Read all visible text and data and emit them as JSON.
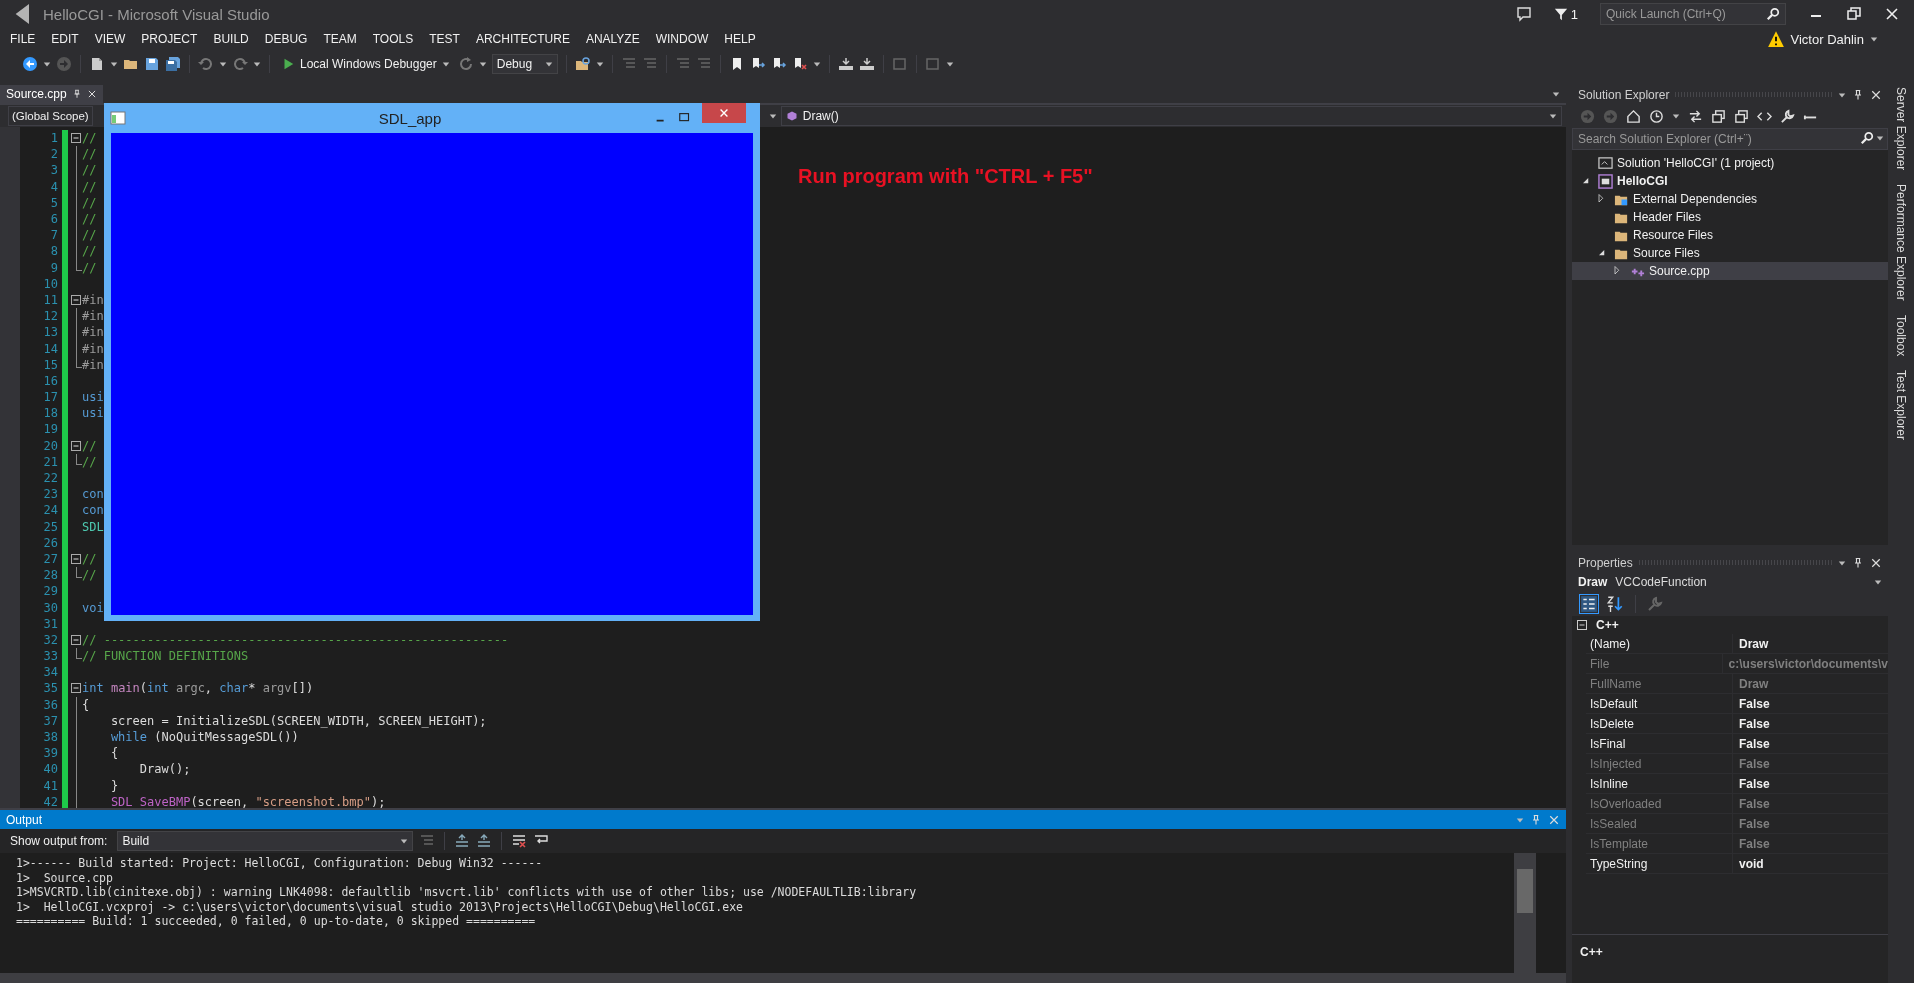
{
  "window": {
    "title": "HelloCGI - Microsoft Visual Studio",
    "notification_count": "1",
    "quick_launch": {
      "placeholder": "Quick Launch (Ctrl+Q)"
    }
  },
  "menu": [
    "FILE",
    "EDIT",
    "VIEW",
    "PROJECT",
    "BUILD",
    "DEBUG",
    "TEAM",
    "TOOLS",
    "TEST",
    "ARCHITECTURE",
    "ANALYZE",
    "WINDOW",
    "HELP"
  ],
  "account": {
    "name": "Victor Dahlin"
  },
  "toolbar": {
    "debugger": "Local Windows Debugger",
    "configuration": "Debug"
  },
  "document_tabs": [
    {
      "label": "Source.cpp",
      "selected": true
    }
  ],
  "navigation_bar": {
    "scope": "(Global Scope)",
    "member": "Draw()"
  },
  "editor": {
    "lines": [
      {
        "number": "1",
        "kind": "opener",
        "changed": true,
        "tokens": [
          {
            "kind": "comment",
            "text": "//"
          }
        ]
      },
      {
        "number": "2",
        "kind": "inside",
        "changed": true,
        "tokens": [
          {
            "kind": "comment",
            "text": "//"
          }
        ]
      },
      {
        "number": "3",
        "kind": "inside",
        "changed": true,
        "tokens": [
          {
            "kind": "comment",
            "text": "//"
          }
        ]
      },
      {
        "number": "4",
        "kind": "inside",
        "changed": true,
        "tokens": [
          {
            "kind": "comment",
            "text": "//"
          }
        ]
      },
      {
        "number": "5",
        "kind": "inside",
        "changed": true,
        "tokens": [
          {
            "kind": "comment",
            "text": "//"
          }
        ]
      },
      {
        "number": "6",
        "kind": "inside",
        "changed": true,
        "tokens": [
          {
            "kind": "comment",
            "text": "//"
          }
        ]
      },
      {
        "number": "7",
        "kind": "inside",
        "changed": true,
        "tokens": [
          {
            "kind": "comment",
            "text": "//"
          }
        ]
      },
      {
        "number": "8",
        "kind": "inside",
        "changed": true,
        "tokens": [
          {
            "kind": "comment",
            "text": "//"
          }
        ]
      },
      {
        "number": "9",
        "kind": "closer",
        "changed": true,
        "tokens": [
          {
            "kind": "comment",
            "text": "//"
          }
        ]
      },
      {
        "number": "10",
        "changed": true
      },
      {
        "number": "11",
        "kind": "opener",
        "changed": true,
        "tokens": [
          {
            "kind": "preprocessor",
            "text": "#in"
          }
        ]
      },
      {
        "number": "12",
        "kind": "inside",
        "changed": true,
        "tokens": [
          {
            "kind": "preprocessor",
            "text": "#in"
          }
        ]
      },
      {
        "number": "13",
        "kind": "inside",
        "changed": true,
        "tokens": [
          {
            "kind": "preprocessor",
            "text": "#in"
          }
        ]
      },
      {
        "number": "14",
        "kind": "inside",
        "changed": true,
        "tokens": [
          {
            "kind": "preprocessor",
            "text": "#in"
          }
        ]
      },
      {
        "number": "15",
        "kind": "closer",
        "changed": true,
        "tokens": [
          {
            "kind": "preprocessor",
            "text": "#in"
          }
        ]
      },
      {
        "number": "16",
        "changed": true
      },
      {
        "number": "17",
        "changed": true,
        "tokens": [
          {
            "kind": "keyword",
            "text": "usi"
          }
        ]
      },
      {
        "number": "18",
        "changed": true,
        "tokens": [
          {
            "kind": "keyword",
            "text": "usi"
          }
        ]
      },
      {
        "number": "19",
        "changed": true
      },
      {
        "number": "20",
        "kind": "opener",
        "changed": true,
        "tokens": [
          {
            "kind": "comment",
            "text": "//"
          }
        ]
      },
      {
        "number": "21",
        "kind": "closer",
        "changed": true,
        "tokens": [
          {
            "kind": "comment",
            "text": "//"
          }
        ]
      },
      {
        "number": "22",
        "changed": true
      },
      {
        "number": "23",
        "changed": true,
        "tokens": [
          {
            "kind": "keyword",
            "text": "con"
          }
        ]
      },
      {
        "number": "24",
        "changed": true,
        "tokens": [
          {
            "kind": "keyword",
            "text": "con"
          }
        ]
      },
      {
        "number": "25",
        "changed": true,
        "tokens": [
          {
            "kind": "type",
            "text": "SDL"
          }
        ]
      },
      {
        "number": "26",
        "changed": true
      },
      {
        "number": "27",
        "kind": "opener",
        "changed": true,
        "tokens": [
          {
            "kind": "comment",
            "text": "//"
          }
        ]
      },
      {
        "number": "28",
        "kind": "closer",
        "changed": true,
        "tokens": [
          {
            "kind": "comment",
            "text": "//"
          }
        ]
      },
      {
        "number": "29",
        "changed": true
      },
      {
        "number": "30",
        "changed": true,
        "tokens": [
          {
            "kind": "keyword",
            "text": "voi"
          }
        ]
      },
      {
        "number": "31",
        "changed": true
      },
      {
        "number": "32",
        "kind": "opener",
        "changed": true,
        "tokens": [
          {
            "kind": "comment",
            "text": "// --------------------------------------------------------"
          }
        ]
      },
      {
        "number": "33",
        "kind": "closer",
        "changed": true,
        "tokens": [
          {
            "kind": "comment",
            "text": "// FUNCTION DEFINITIONS"
          }
        ]
      },
      {
        "number": "34",
        "changed": true
      },
      {
        "number": "35",
        "kind": "opener",
        "changed": true,
        "tokens": [
          {
            "kind": "keyword",
            "text": "int"
          },
          {
            "kind": "function",
            "text": " main"
          },
          {
            "kind": "plain",
            "text": "("
          },
          {
            "kind": "keyword",
            "text": "int"
          },
          {
            "kind": "parameter",
            "text": " argc"
          },
          {
            "kind": "plain",
            "text": ", "
          },
          {
            "kind": "keyword",
            "text": "char"
          },
          {
            "kind": "plain",
            "text": "* "
          },
          {
            "kind": "parameter",
            "text": "argv"
          },
          {
            "kind": "plain",
            "text": "[])"
          }
        ]
      },
      {
        "number": "36",
        "kind": "inside",
        "changed": true,
        "tokens": [
          {
            "kind": "plain",
            "text": "{"
          }
        ]
      },
      {
        "number": "37",
        "kind": "inside",
        "changed": true,
        "tokens": [
          {
            "kind": "plain",
            "text": "    screen = InitializeSDL(SCREEN_WIDTH, SCREEN_HEIGHT);"
          }
        ]
      },
      {
        "number": "38",
        "kind": "inside",
        "changed": true,
        "tokens": [
          {
            "kind": "keyword",
            "text": "    while"
          },
          {
            "kind": "plain",
            "text": " (NoQuitMessageSDL())"
          }
        ]
      },
      {
        "number": "39",
        "kind": "inside",
        "changed": true,
        "tokens": [
          {
            "kind": "plain",
            "text": "    {"
          }
        ]
      },
      {
        "number": "40",
        "kind": "inside",
        "changed": true,
        "tokens": [
          {
            "kind": "plain",
            "text": "        Draw();"
          }
        ]
      },
      {
        "number": "41",
        "kind": "inside",
        "changed": true,
        "tokens": [
          {
            "kind": "plain",
            "text": "    }"
          }
        ]
      },
      {
        "number": "42",
        "kind": "inside",
        "changed": true,
        "tokens": [
          {
            "kind": "macro",
            "text": "    SDL_SaveBMP"
          },
          {
            "kind": "plain",
            "text": "(screen, "
          },
          {
            "kind": "string",
            "text": "\"screenshot.bmp\""
          },
          {
            "kind": "plain",
            "text": ");"
          }
        ]
      }
    ]
  },
  "annotation": "Run program with \"CTRL + F5\"",
  "sdl_window": {
    "title": "SDL_app"
  },
  "output": {
    "title": "Output",
    "active": true,
    "source_label": "Show output from:",
    "source": "Build",
    "lines": [
      "1>------ Build started: Project: HelloCGI, Configuration: Debug Win32 ------",
      "1>  Source.cpp",
      "1>MSVCRTD.lib(cinitexe.obj) : warning LNK4098: defaultlib 'msvcrt.lib' conflicts with use of other libs; use /NODEFAULTLIB:library",
      "1>  HelloCGI.vcxproj -> c:\\users\\victor\\documents\\visual studio 2013\\Projects\\HelloCGI\\Debug\\HelloCGI.exe",
      "========== Build: 1 succeeded, 0 failed, 0 up-to-date, 0 skipped =========="
    ]
  },
  "solution_explorer": {
    "title": "Solution Explorer",
    "active": false,
    "search": {
      "placeholder": "Search Solution Explorer (Ctrl+¨)"
    },
    "tree": [
      {
        "label": "Solution 'HelloCGI' (1 project)",
        "kind": "solution",
        "selected": false,
        "children": [
          {
            "label": "HelloCGI",
            "kind": "project",
            "selected": false,
            "expanded": true,
            "children": [
              {
                "label": "External Dependencies",
                "kind": "dependencies",
                "selected": false,
                "expanded": false
              },
              {
                "label": "Header Files",
                "kind": "folder",
                "selected": false
              },
              {
                "label": "Resource Files",
                "kind": "folder",
                "selected": false
              },
              {
                "label": "Source Files",
                "kind": "folder",
                "selected": false,
                "expanded": true,
                "children": [
                  {
                    "label": "Source.cpp",
                    "kind": "file",
                    "selected": true,
                    "expanded": false
                  }
                ]
              }
            ]
          }
        ]
      }
    ]
  },
  "properties": {
    "title": "Properties",
    "active": false,
    "object": "Draw",
    "object_type": "VCCodeFunction",
    "category": {
      "label": "C++",
      "expanded": true
    },
    "rows": [
      {
        "name": "(Name)",
        "value": "Draw",
        "disabled": false
      },
      {
        "name": "File",
        "value": "c:\\users\\victor\\documents\\v",
        "disabled": true
      },
      {
        "name": "FullName",
        "value": "Draw",
        "disabled": true
      },
      {
        "name": "IsDefault",
        "value": "False",
        "disabled": false
      },
      {
        "name": "IsDelete",
        "value": "False",
        "disabled": false
      },
      {
        "name": "IsFinal",
        "value": "False",
        "disabled": false
      },
      {
        "name": "IsInjected",
        "value": "False",
        "disabled": true
      },
      {
        "name": "IsInline",
        "value": "False",
        "disabled": false
      },
      {
        "name": "IsOverloaded",
        "value": "False",
        "disabled": true
      },
      {
        "name": "IsSealed",
        "value": "False",
        "disabled": true
      },
      {
        "name": "IsTemplate",
        "value": "False",
        "disabled": true
      },
      {
        "name": "TypeString",
        "value": "void",
        "disabled": false
      }
    ],
    "description": "C++"
  },
  "side_tabs": [
    "Server Explorer",
    "Performance Explorer",
    "Toolbox",
    "Test Explorer"
  ]
}
